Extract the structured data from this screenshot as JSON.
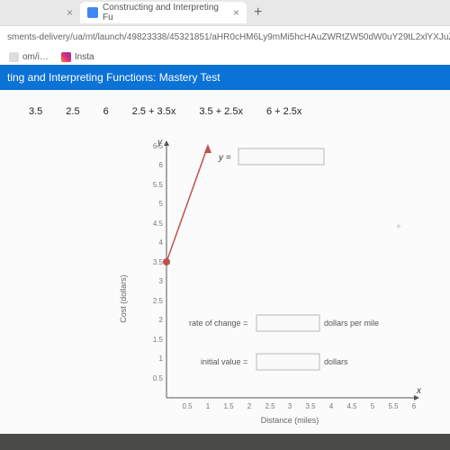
{
  "browser": {
    "tab": {
      "title": "Constructing and Interpreting Fu"
    },
    "url": "sments-delivery/ua/mt/launch/49823338/45321851/aHR0cHM6Ly9mMi5hcHAuZWRtZW50dW0uY29tL2xlYXJuZXItdWk",
    "bookmarks": {
      "item1": "om/i…",
      "item2": "Insta"
    }
  },
  "page": {
    "title": "ting and Interpreting Functions: Mastery Test"
  },
  "options": {
    "o1": "3.5",
    "o2": "2.5",
    "o3": "6",
    "o4": "2.5 + 3.5x",
    "o5": "3.5 + 2.5x",
    "o6": "6 + 2.5x"
  },
  "chart_data": {
    "type": "line",
    "xlabel": "Distance (miles)",
    "ylabel": "Cost (dollars)",
    "x_ticks": [
      "0.5",
      "1",
      "1.5",
      "2",
      "2.5",
      "3",
      "3.5",
      "4",
      "4.5",
      "5",
      "5.5",
      "6"
    ],
    "y_ticks": [
      "0.5",
      "1",
      "1.5",
      "2",
      "2.5",
      "3",
      "3.5",
      "4",
      "4.5",
      "5",
      "5.5",
      "6",
      "6.5"
    ],
    "xlim": [
      0,
      6
    ],
    "ylim": [
      0,
      6.5
    ],
    "points": [
      {
        "x": 0,
        "y": 3.5
      },
      {
        "x": 1,
        "y": 6.5
      }
    ],
    "labels": {
      "y_equals": "y =",
      "rate_of_change": "rate of change =",
      "rate_unit": "dollars per mile",
      "initial_value": "initial value =",
      "initial_unit": "dollars",
      "y_var": "y",
      "x_var": "x"
    }
  }
}
